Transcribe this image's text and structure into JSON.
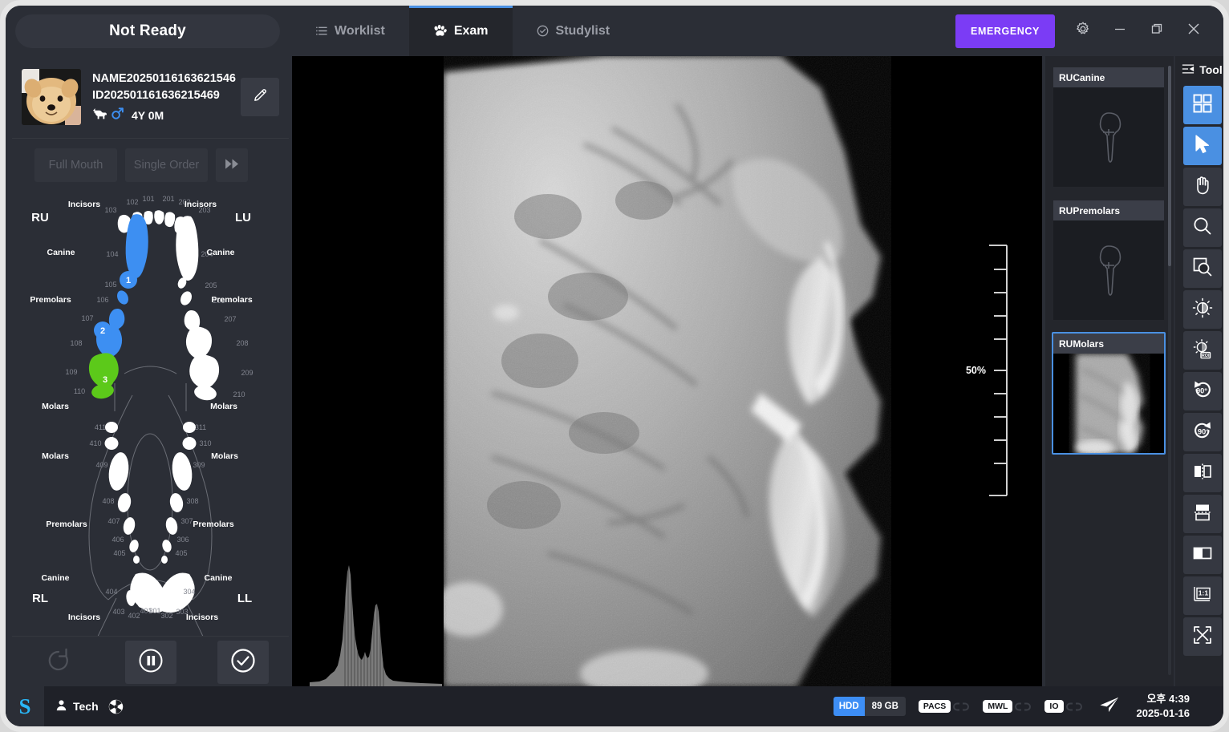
{
  "topbar": {
    "status_label": "Not Ready",
    "tabs": [
      {
        "label": "Worklist",
        "icon": "list-icon",
        "active": false
      },
      {
        "label": "Exam",
        "icon": "paw-icon",
        "active": true
      },
      {
        "label": "Studylist",
        "icon": "check-circle-icon",
        "active": false
      }
    ],
    "emergency_label": "EMERGENCY",
    "settings_icon": "gear-icon",
    "minimize_icon": "minimize-icon",
    "restore_icon": "restore-icon",
    "close_icon": "close-icon",
    "accent_color": "#4a90e2",
    "emergency_color": "#7b3cf5"
  },
  "patient": {
    "name": "NAME20250116163621546",
    "id": "ID202501161636215469",
    "species_icon": "dog-icon",
    "sex_icon": "male-icon",
    "age": "4Y 0M",
    "edit_icon": "pencil-icon"
  },
  "order": {
    "full_mouth_label": "Full Mouth",
    "single_order_label": "Single Order",
    "next_icon": "fast-forward-icon"
  },
  "dental_chart": {
    "quadrants": {
      "ru": "RU",
      "lu": "LU",
      "rl": "RL",
      "ll": "LL"
    },
    "group_labels": {
      "incisors": "Incisors",
      "canine": "Canine",
      "premolars": "Premolars",
      "molars": "Molars"
    },
    "upper_right_numbers": [
      "101",
      "102",
      "103",
      "104",
      "105",
      "106",
      "107",
      "108",
      "109",
      "110"
    ],
    "upper_left_numbers": [
      "201",
      "202",
      "203",
      "204",
      "205",
      "206",
      "207",
      "208",
      "209",
      "210"
    ],
    "lower_right_numbers": [
      "401",
      "402",
      "403",
      "404",
      "405",
      "406",
      "407",
      "408",
      "409",
      "410",
      "411"
    ],
    "lower_left_numbers": [
      "301",
      "302",
      "303",
      "304",
      "305",
      "306",
      "307",
      "308",
      "309",
      "310",
      "311"
    ],
    "markers": [
      {
        "label": "1",
        "color": "#3d8ff2"
      },
      {
        "label": "2",
        "color": "#3d8ff2"
      },
      {
        "label": "3",
        "color": "#5cc91a"
      }
    ],
    "selected_color": "#3d8ff2",
    "captured_color": "#5cc91a",
    "default_color": "#ffffff"
  },
  "actions": {
    "reset_icon": "undo-icon",
    "pause_icon": "pause-circle-icon",
    "confirm_icon": "check-circle-icon"
  },
  "viewer": {
    "zoom_label": "50%",
    "ruler_icon": "vertical-scale",
    "histogram_icon": "histogram"
  },
  "thumbnails": [
    {
      "title": "RUCanine",
      "state": "empty",
      "selected": false
    },
    {
      "title": "RUPremolars",
      "state": "empty",
      "selected": false
    },
    {
      "title": "RUMolars",
      "state": "captured",
      "selected": true
    }
  ],
  "toolpanel": {
    "header_label": "Tool",
    "header_icon": "panel-collapse-icon",
    "tools": [
      {
        "name": "layout-grid-icon",
        "active": true
      },
      {
        "name": "cursor-arrow-icon",
        "active": true
      },
      {
        "name": "pan-hand-icon",
        "active": false
      },
      {
        "name": "magnifier-icon",
        "active": false
      },
      {
        "name": "region-zoom-icon",
        "active": false
      },
      {
        "name": "brightness-contrast-icon",
        "active": false
      },
      {
        "name": "brightness-roi-icon",
        "active": false
      },
      {
        "name": "rotate-left-90-icon",
        "active": false
      },
      {
        "name": "rotate-right-90-icon",
        "active": false
      },
      {
        "name": "flip-horizontal-icon",
        "active": false
      },
      {
        "name": "flip-vertical-icon",
        "active": false
      },
      {
        "name": "invert-icon",
        "active": false
      },
      {
        "name": "actual-size-1-1-icon",
        "active": false
      },
      {
        "name": "fit-to-screen-icon",
        "active": false
      }
    ],
    "rotate_left_label": "90",
    "rotate_right_label": "90",
    "one_to_one_label": "1:1"
  },
  "bottombar": {
    "logo": "S",
    "user_icon": "user-icon",
    "user_name": "Tech",
    "radiation_icon": "radiation-icon",
    "hdd_key": "HDD",
    "hdd_value": "89 GB",
    "services": [
      {
        "label": "PACS",
        "linked": false
      },
      {
        "label": "MWL",
        "linked": false
      },
      {
        "label": "IO",
        "linked": false
      }
    ],
    "send_icon": "send-icon",
    "time": "오후 4:39",
    "date": "2025-01-16"
  }
}
